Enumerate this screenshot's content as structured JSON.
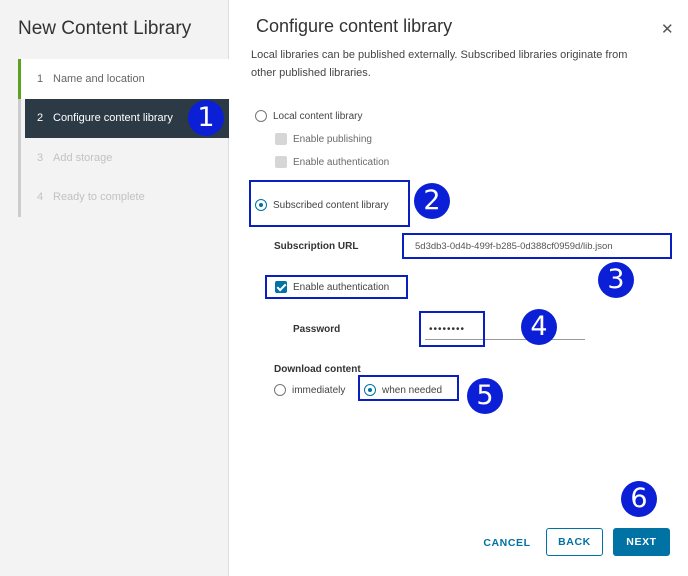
{
  "sidebar": {
    "title": "New Content Library",
    "steps": [
      {
        "num": "1",
        "label": "Name and location"
      },
      {
        "num": "2",
        "label": "Configure content library"
      },
      {
        "num": "3",
        "label": "Add storage"
      },
      {
        "num": "4",
        "label": "Ready to complete"
      }
    ]
  },
  "dialog": {
    "title": "Configure content library",
    "close_icon": "close-icon",
    "description": "Local libraries can be published externally. Subscribed libraries originate from other published libraries."
  },
  "form": {
    "local_label": "Local content library",
    "enable_publishing": "Enable publishing",
    "enable_auth_local": "Enable authentication",
    "subscribed_label": "Subscribed content library",
    "subscription_url_label": "Subscription URL",
    "subscription_url_value": "5d3db3-0d4b-499f-b285-0d388cf0959d/lib.json",
    "enable_auth_subscribed": "Enable authentication",
    "password_label": "Password",
    "password_value": "••••••••",
    "download_content_label": "Download content",
    "immediately": "immediately",
    "when_needed": "when needed"
  },
  "annotations": [
    "1",
    "2",
    "3",
    "4",
    "5",
    "6"
  ],
  "buttons": {
    "cancel": "CANCEL",
    "back": "BACK",
    "next": "NEXT"
  },
  "colors": {
    "accent": "#0072a3",
    "active_step_bg": "#2c3a46",
    "done_step": "#5aa220",
    "annotation": "#0a1fd6"
  }
}
